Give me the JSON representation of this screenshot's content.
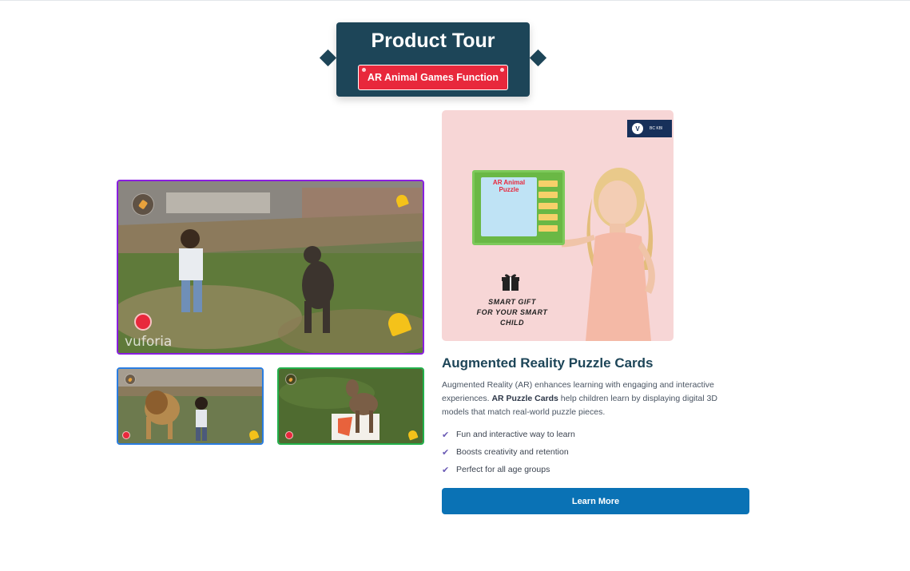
{
  "header": {
    "title": "Product Tour",
    "subtitle": "AR Animal Games Function"
  },
  "media": {
    "main_video": {
      "watermark": "vuforia"
    }
  },
  "product_image": {
    "brand_initial": "V",
    "brand_name": "BC KBI",
    "box_title": "AR Animal Puzzle",
    "tagline_line1": "SMART GIFT",
    "tagline_line2": "FOR YOUR SMART CHILD"
  },
  "content": {
    "title": "Augmented Reality Puzzle Cards",
    "desc_part1": "Augmented Reality (AR) enhances learning with engaging and interactive experiences. ",
    "desc_bold": "AR Puzzle Cards",
    "desc_part2": " help children learn by displaying digital 3D models that match real-world puzzle pieces.",
    "features": [
      "Fun and interactive way to learn",
      "Boosts creativity and retention",
      "Perfect for all age groups"
    ],
    "button_label": "Learn More"
  },
  "colors": {
    "header_bg": "#1d4558",
    "badge_red": "#e8283c",
    "main_border": "#8a1ee0",
    "thumb1_border": "#2a7de1",
    "thumb2_border": "#22b04b",
    "button_bg": "#0a72b5",
    "check_color": "#6b5bb5"
  },
  "icons": {
    "feature_bullet": "check-icon"
  }
}
